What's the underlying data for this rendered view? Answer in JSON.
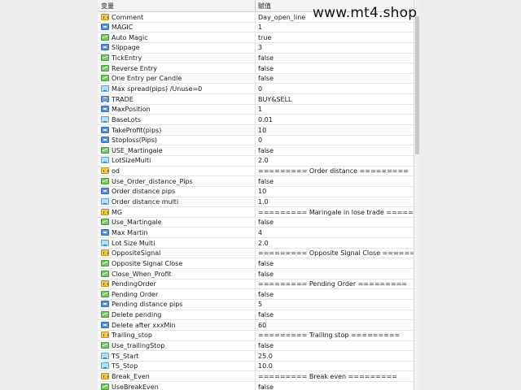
{
  "header": {
    "col_variable": "变量",
    "col_value": "赋值"
  },
  "watermark": "www.mt4.shop",
  "rows": [
    {
      "name": "Comment",
      "value": "Day_open_line",
      "icon": "str"
    },
    {
      "name": "MAGIC",
      "value": "1",
      "icon": "int"
    },
    {
      "name": "Auto Magic",
      "value": "true",
      "icon": "bool"
    },
    {
      "name": "Slippage",
      "value": "3",
      "icon": "int"
    },
    {
      "name": "TickEntry",
      "value": "false",
      "icon": "bool"
    },
    {
      "name": "Reverse Entry",
      "value": "false",
      "icon": "bool"
    },
    {
      "name": "One Entry per Candle",
      "value": "false",
      "icon": "bool"
    },
    {
      "name": "Max spread(pips) /Unuse=0",
      "value": "0",
      "icon": "dbl"
    },
    {
      "name": "TRADE",
      "value": "BUY&SELL",
      "icon": "enm"
    },
    {
      "name": "MaxPosition",
      "value": "1",
      "icon": "int"
    },
    {
      "name": "BaseLots",
      "value": "0.01",
      "icon": "dbl"
    },
    {
      "name": "TakeProfit(pips)",
      "value": "10",
      "icon": "int"
    },
    {
      "name": "Stoploss(Pips)",
      "value": "0",
      "icon": "int"
    },
    {
      "name": "USE_Martingale",
      "value": "false",
      "icon": "bool"
    },
    {
      "name": "LotSizeMulti",
      "value": "2.0",
      "icon": "dbl"
    },
    {
      "name": "od",
      "value": "========= Order distance =========",
      "icon": "str"
    },
    {
      "name": "Use_Order_distance_Pips",
      "value": "false",
      "icon": "bool"
    },
    {
      "name": "Order distance pips",
      "value": "10",
      "icon": "int"
    },
    {
      "name": "Order distance multi",
      "value": "1.0",
      "icon": "dbl"
    },
    {
      "name": "MG",
      "value": "========= Maringale in lose trade =========",
      "icon": "str"
    },
    {
      "name": "Use_Martingale",
      "value": "false",
      "icon": "bool"
    },
    {
      "name": "Max Martin",
      "value": "4",
      "icon": "int"
    },
    {
      "name": "Lot Size Multi",
      "value": "2.0",
      "icon": "dbl"
    },
    {
      "name": "OppositeSignal",
      "value": "========= Opposite Signal Close =========",
      "icon": "str"
    },
    {
      "name": "Opposite Signal Close",
      "value": "false",
      "icon": "bool"
    },
    {
      "name": "Close_When_Profit",
      "value": "false",
      "icon": "bool"
    },
    {
      "name": "PendingOrder",
      "value": "========= Pending Order =========",
      "icon": "str"
    },
    {
      "name": "Pending Order",
      "value": "false",
      "icon": "bool"
    },
    {
      "name": "Pending distance pips",
      "value": "5",
      "icon": "int"
    },
    {
      "name": "Delete pending",
      "value": "false",
      "icon": "bool"
    },
    {
      "name": "Delete after xxxMin",
      "value": "60",
      "icon": "int"
    },
    {
      "name": "Trailing_stop",
      "value": "========= Trailing stop =========",
      "icon": "str"
    },
    {
      "name": "Use_trailingStop",
      "value": "false",
      "icon": "bool"
    },
    {
      "name": "TS_Start",
      "value": "25.0",
      "icon": "dbl"
    },
    {
      "name": "TS_Stop",
      "value": "10.0",
      "icon": "dbl"
    },
    {
      "name": "Break_Even",
      "value": "========= Break even =========",
      "icon": "str"
    },
    {
      "name": "UseBreakEven",
      "value": "false",
      "icon": "bool"
    }
  ]
}
